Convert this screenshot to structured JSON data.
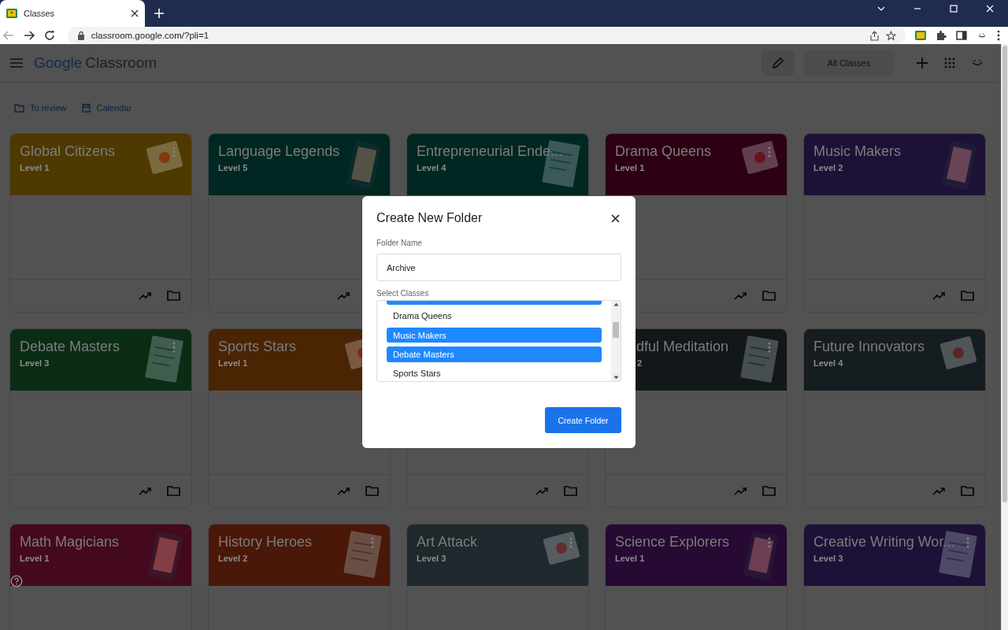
{
  "browser": {
    "tab": {
      "title": "Classes"
    },
    "url": "classroom.google.com/?pli=1"
  },
  "app": {
    "brand": "Google",
    "product": "Classroom",
    "all_classes": "All Classes"
  },
  "nav": [
    {
      "label": "To review",
      "kind": "review"
    },
    {
      "label": "Calendar",
      "kind": "calendar"
    }
  ],
  "classes": [
    {
      "title": "Global Citizens",
      "level": "Level 1",
      "color": "#4e3900",
      "menu": true,
      "trend_icon": true,
      "folder_icon": true
    },
    {
      "title": "Language Legends",
      "level": "Level 5",
      "color": "#002722",
      "menu": false,
      "trend_icon": true,
      "folder_icon": false
    },
    {
      "title": "Entrepreneurial Ende...",
      "level": "Level 4",
      "color": "#002722",
      "menu": false,
      "trend_icon": false,
      "folder_icon": false
    },
    {
      "title": "Drama Queens",
      "level": "Level 1",
      "color": "#2d0014",
      "menu": true,
      "trend_icon": true,
      "folder_icon": true
    },
    {
      "title": "Music Makers",
      "level": "Level 2",
      "color": "#1e1138",
      "menu": false,
      "trend_icon": true,
      "folder_icon": true
    },
    {
      "title": "Debate Masters",
      "level": "Level 3",
      "color": "#0a2d14",
      "menu": true,
      "trend_icon": true,
      "folder_icon": true
    },
    {
      "title": "Sports Stars",
      "level": "Level 1",
      "color": "#4a2403",
      "menu": false,
      "trend_icon": true,
      "folder_icon": true
    },
    {
      "trend_icon": true,
      "folder_icon": true
    },
    {
      "title": "dful Meditation",
      "level": "2",
      "color": "#121719",
      "menu": true,
      "trend_icon": true,
      "folder_icon": true,
      "cut_left": true
    },
    {
      "title": "Future Innovators",
      "level": "Level 4",
      "color": "#161d20",
      "menu": false,
      "trend_icon": true,
      "folder_icon": true
    },
    {
      "title": "Math Magicians",
      "level": "Level 1",
      "color": "#45091f",
      "menu": false,
      "trend_icon": false,
      "folder_icon": false,
      "help": true
    },
    {
      "title": "History Heroes",
      "level": "Level 2",
      "color": "#4a1808",
      "menu": true,
      "trend_icon": false,
      "folder_icon": false
    },
    {
      "title": "Art Attack",
      "level": "Level 3",
      "color": "#1f282c",
      "menu": true,
      "trend_icon": false,
      "folder_icon": false
    },
    {
      "title": "Science Explorers",
      "level": "Level 1",
      "color": "#270a34",
      "menu": true,
      "trend_icon": false,
      "folder_icon": false
    },
    {
      "title": "Creative Writing Wor...",
      "level": "Level 3",
      "color": "#1e1138",
      "menu": true,
      "trend_icon": false,
      "folder_icon": false
    }
  ],
  "dialog": {
    "title": "Create New Folder",
    "name_label": "Folder Name",
    "name_value": "Archive",
    "classes_label": "Select Classes",
    "options": [
      {
        "selected": true,
        "cut": true
      },
      {
        "label": "Drama Queens",
        "selected": false
      },
      {
        "label": "Music Makers",
        "selected": true
      },
      {
        "label": "Debate Masters",
        "selected": true
      },
      {
        "label": "Sports Stars",
        "selected": false
      }
    ],
    "button": "Create Folder"
  }
}
